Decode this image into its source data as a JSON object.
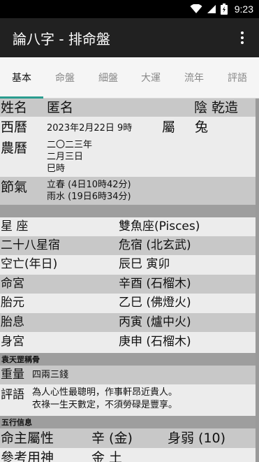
{
  "status_bar": {
    "time": "9:23"
  },
  "app_bar": {
    "title": "論八字 - 排命盤"
  },
  "tabs": [
    {
      "label": "基本",
      "active": true
    },
    {
      "label": "命盤",
      "active": false
    },
    {
      "label": "細盤",
      "active": false
    },
    {
      "label": "大運",
      "active": false
    },
    {
      "label": "流年",
      "active": false
    },
    {
      "label": "評語",
      "active": false
    }
  ],
  "basic": {
    "name_label": "姓名",
    "name_value": "匿名",
    "gender_value": "陰 乾造",
    "solar_label": "西曆",
    "solar_value": "2023年2月22日 9時",
    "zodiac_label": "屬",
    "zodiac_value": "兔",
    "lunar_label": "農曆",
    "lunar_lines": [
      "二〇二三年",
      "二月三日",
      "巳時"
    ],
    "solar_term_label": "節氣",
    "solar_term_lines": [
      "立春 (4日10時42分)",
      "雨水 (19日6時34分)"
    ]
  },
  "details": [
    {
      "label": "星 座",
      "value": "雙魚座(Pisces)"
    },
    {
      "label": "二十八星宿",
      "value": "危宿 (北玄武)"
    },
    {
      "label": "空亡(年日)",
      "value": "辰巳 寅卯"
    },
    {
      "label": "命宮",
      "value": "辛酉 (石榴木)"
    },
    {
      "label": "胎元",
      "value": "乙巳 (佛燈火)"
    },
    {
      "label": "胎息",
      "value": "丙寅 (爐中火)"
    },
    {
      "label": "身宮",
      "value": "庚申 (石榴木)"
    }
  ],
  "bone_weight": {
    "section_title": "袁天罡稱骨",
    "weight_label": "重量",
    "weight_value": "四兩三錢",
    "comment_label": "評語",
    "comment_lines": [
      "為人心性最聰明，作事軒昂近貴人。",
      "衣祿一生天數定，不須勞碌是豐享。"
    ]
  },
  "five_elements": {
    "section_title": "五行信息",
    "master_label": "命主屬性",
    "master_value": "辛 (金)",
    "strength_value": "身弱 (10)",
    "useful_label": "參考用神",
    "useful_value": "金 土"
  },
  "colors": {
    "app_bar": "#212121",
    "tab_indicator": "#2a9d8f",
    "row_dark": "#c8c8c8",
    "row_light": "#ececec",
    "section_header": "#9e9e9e"
  }
}
